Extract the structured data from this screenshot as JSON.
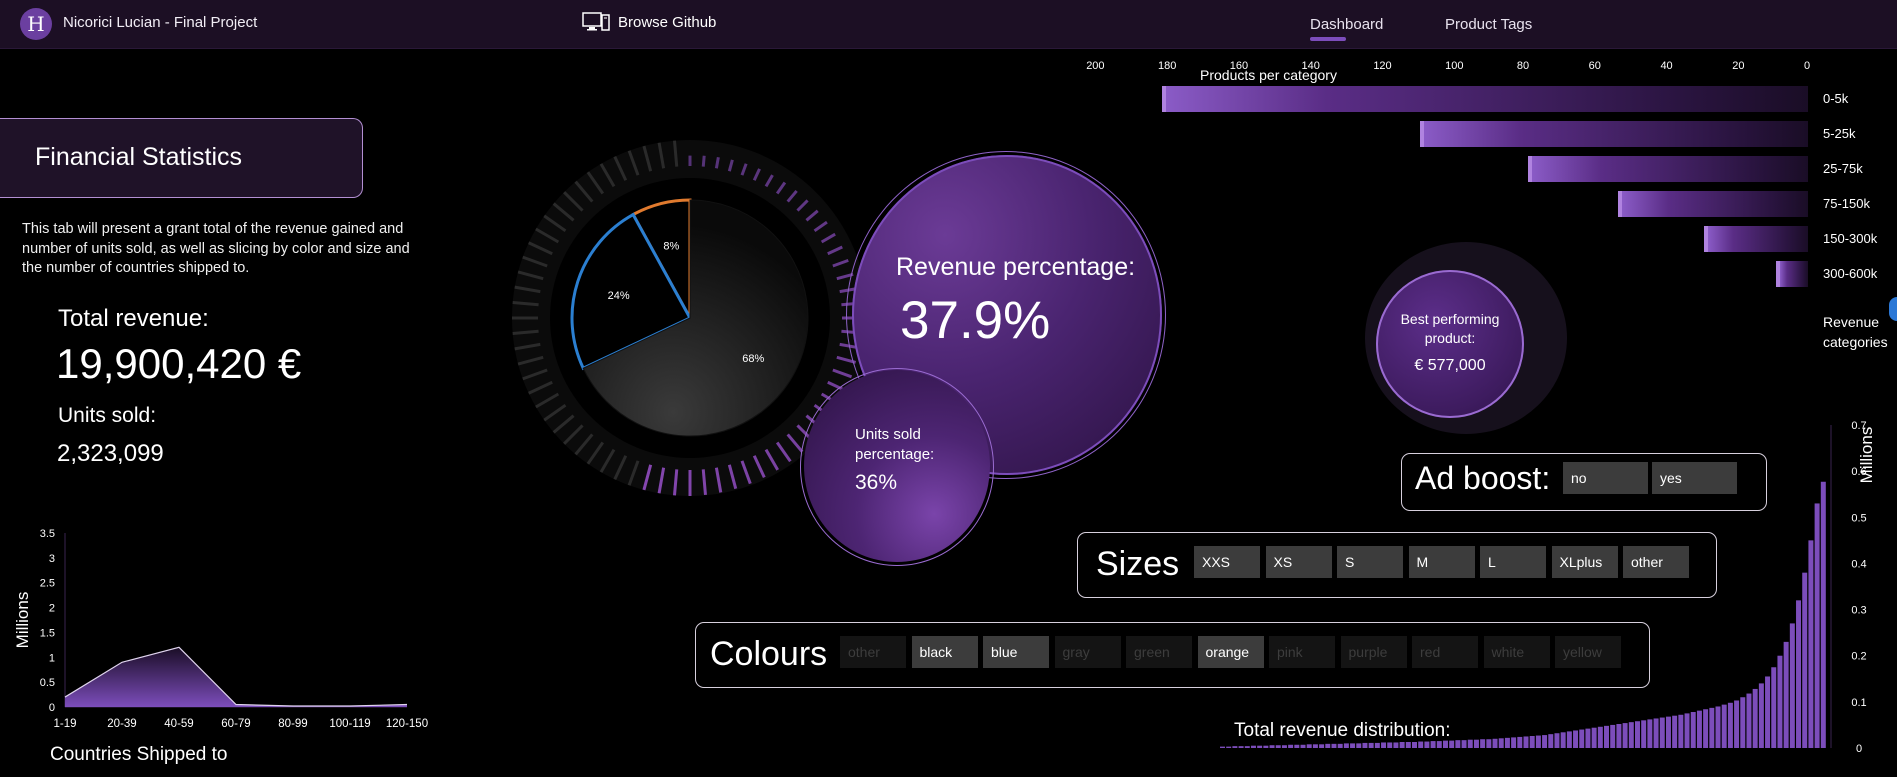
{
  "header": {
    "logo_letter": "H",
    "app_title": "Nicorici Lucian - Final Project",
    "browse_label": "Browse Github",
    "tabs": [
      {
        "label": "Dashboard",
        "active": true
      },
      {
        "label": "Product Tags",
        "active": false
      }
    ]
  },
  "financial": {
    "section_title": "Financial Statistics",
    "description": "This tab will present a grant total of the revenue gained and number of units sold, as well as slicing by color and size and the number of countries shipped to.",
    "total_revenue_label": "Total revenue:",
    "total_revenue_value": "19,900,420 €",
    "units_sold_label": "Units sold:",
    "units_sold_value": "2,323,099"
  },
  "gauge": {
    "slices": [
      {
        "label": "8%",
        "value": 8,
        "color": "#e07a2e"
      },
      {
        "label": "24%",
        "value": 24,
        "color": "#2b7fd1"
      },
      {
        "label": "68%",
        "value": 68,
        "color": "#222222"
      }
    ]
  },
  "revenue_bubble": {
    "label": "Revenue percentage:",
    "value": "37.9%"
  },
  "units_bubble": {
    "label_line1": "Units sold",
    "label_line2": "percentage:",
    "value": "36%"
  },
  "best_product": {
    "label_line1": "Best performing",
    "label_line2": "product:",
    "value": "€ 577,000"
  },
  "slicers": {
    "ad_boost": {
      "title": "Ad boost:",
      "options": [
        {
          "label": "no",
          "selected": true
        },
        {
          "label": "yes",
          "selected": true
        }
      ]
    },
    "sizes": {
      "title": "Sizes",
      "options": [
        {
          "label": "XXS",
          "selected": true
        },
        {
          "label": "XS",
          "selected": true
        },
        {
          "label": "S",
          "selected": true
        },
        {
          "label": "M",
          "selected": true
        },
        {
          "label": "L",
          "selected": true
        },
        {
          "label": "XLplus",
          "selected": true
        },
        {
          "label": "other",
          "selected": true
        }
      ]
    },
    "colours": {
      "title": "Colours",
      "options": [
        {
          "label": "other",
          "selected": false
        },
        {
          "label": "black",
          "selected": true
        },
        {
          "label": "blue",
          "selected": true
        },
        {
          "label": "gray",
          "selected": false
        },
        {
          "label": "green",
          "selected": false
        },
        {
          "label": "orange",
          "selected": true
        },
        {
          "label": "pink",
          "selected": false
        },
        {
          "label": "purple",
          "selected": false
        },
        {
          "label": "red",
          "selected": false
        },
        {
          "label": "white",
          "selected": false
        },
        {
          "label": "yellow",
          "selected": false
        }
      ]
    }
  },
  "chart_data": [
    {
      "type": "bar",
      "orientation": "horizontal",
      "title": "Products per category",
      "categories": [
        "0-5k",
        "5-25k",
        "25-75k",
        "75-150k",
        "150-300k",
        "300-600k"
      ],
      "values": [
        180,
        108,
        78,
        53,
        29,
        9
      ],
      "xlim": [
        0,
        200
      ],
      "xticks": [
        200,
        180,
        160,
        140,
        120,
        100,
        80,
        60,
        40,
        20,
        0
      ],
      "axis_reversed": true,
      "ylabel": "Revenue categories",
      "colors": {
        "bar": "#7c4dbb"
      }
    },
    {
      "type": "area",
      "xlabel": "Countries Shipped to",
      "ylabel": "Millions",
      "categories": [
        "1-19",
        "20-39",
        "40-59",
        "60-79",
        "80-99",
        "100-119",
        "120-150"
      ],
      "values": [
        0.2,
        0.9,
        1.2,
        0.05,
        0.02,
        0.02,
        0.05
      ],
      "ylim": [
        0,
        3.5
      ],
      "yticks": [
        "0",
        "0.5",
        "1",
        "1.5",
        "2",
        "2.5",
        "3",
        "3.5"
      ],
      "colors": {
        "fill": "#6b3fa0"
      }
    },
    {
      "type": "bar",
      "title": "Total revenue distribution:",
      "ylabel": "Millions",
      "ylim": [
        0,
        0.7
      ],
      "yticks": [
        "0",
        "0.1",
        "0.2",
        "0.3",
        "0.4",
        "0.5",
        "0.6",
        "0.7"
      ],
      "values": [
        0.003,
        0.003,
        0.004,
        0.004,
        0.004,
        0.005,
        0.005,
        0.005,
        0.006,
        0.006,
        0.006,
        0.007,
        0.007,
        0.007,
        0.008,
        0.008,
        0.008,
        0.009,
        0.009,
        0.009,
        0.01,
        0.01,
        0.01,
        0.011,
        0.011,
        0.011,
        0.012,
        0.012,
        0.012,
        0.013,
        0.013,
        0.013,
        0.014,
        0.014,
        0.015,
        0.015,
        0.016,
        0.016,
        0.017,
        0.017,
        0.018,
        0.018,
        0.019,
        0.019,
        0.02,
        0.021,
        0.022,
        0.023,
        0.024,
        0.025,
        0.026,
        0.027,
        0.028,
        0.03,
        0.032,
        0.034,
        0.036,
        0.038,
        0.04,
        0.042,
        0.044,
        0.046,
        0.048,
        0.05,
        0.052,
        0.054,
        0.056,
        0.058,
        0.06,
        0.062,
        0.064,
        0.066,
        0.068,
        0.07,
        0.072,
        0.075,
        0.078,
        0.081,
        0.084,
        0.087,
        0.09,
        0.094,
        0.098,
        0.103,
        0.11,
        0.118,
        0.128,
        0.14,
        0.155,
        0.175,
        0.2,
        0.23,
        0.27,
        0.32,
        0.38,
        0.45,
        0.53,
        0.577
      ],
      "colors": {
        "bar": "#7c4dbb"
      }
    }
  ]
}
